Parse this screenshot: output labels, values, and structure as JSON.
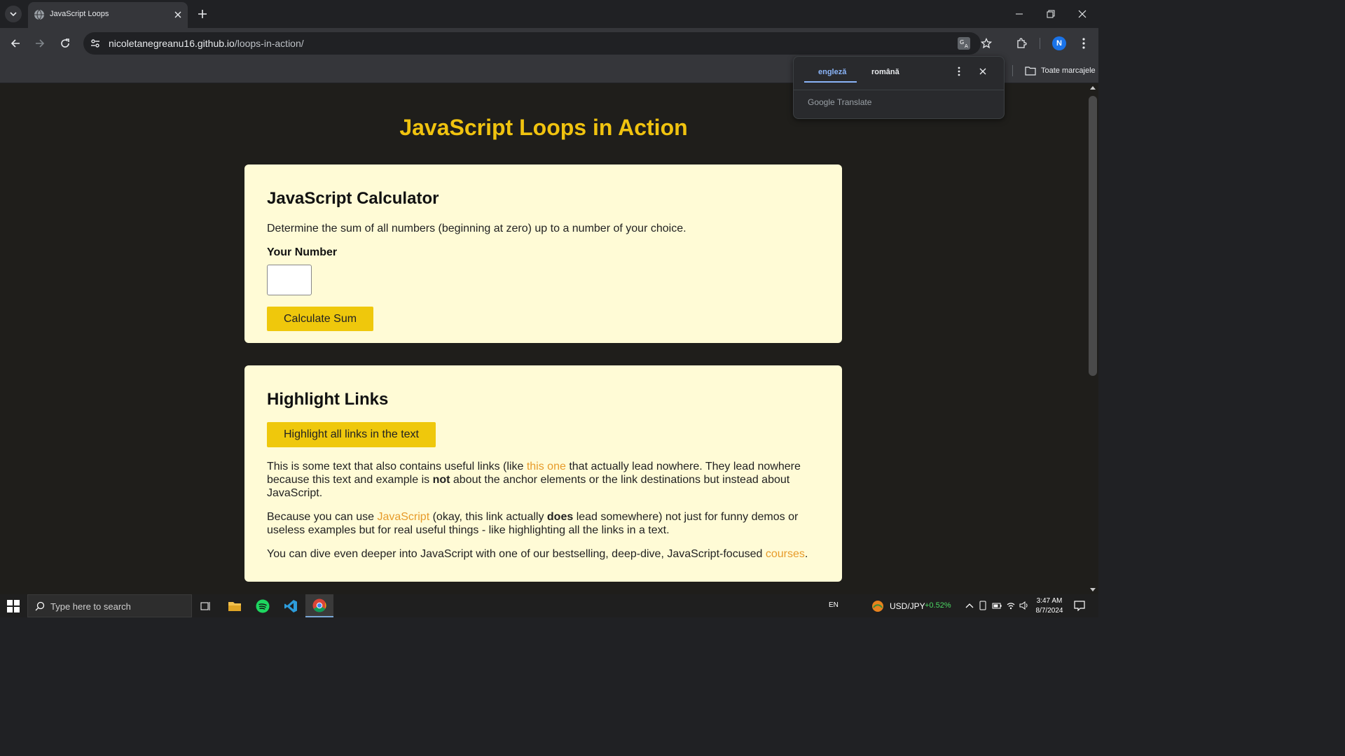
{
  "browser": {
    "tab_title": "JavaScript Loops",
    "url_host": "nicoletanegreanu16.github.io",
    "url_path": "/loops-in-action/",
    "avatar_letter": "N",
    "bookmarks_all": "Toate marcajele"
  },
  "translate_popup": {
    "lang_source": "engleză",
    "lang_target": "română",
    "brand_google": "Google",
    "brand_translate": "Translate"
  },
  "page": {
    "title": "JavaScript Loops in Action",
    "calculator": {
      "heading": "JavaScript Calculator",
      "description": "Determine the sum of all numbers (beginning at zero) up to a number of your choice.",
      "input_label": "Your Number",
      "input_value": "",
      "button_label": "Calculate Sum"
    },
    "links": {
      "heading": "Highlight Links",
      "button_label": "Highlight all links in the text",
      "p1_a": "This is some text that also contains useful links (like ",
      "p1_link": "this one",
      "p1_b": " that actually lead nowhere. They lead nowhere because this text and example is ",
      "p1_bold": "not",
      "p1_c": " about the anchor elements or the link destinations but instead about JavaScript.",
      "p2_a": "Because you can use ",
      "p2_link": "JavaScript",
      "p2_b": " (okay, this link actually ",
      "p2_bold": "does",
      "p2_c": " lead somewhere) not just for funny demos or useless examples but for real useful things - like highlighting all the links in a text.",
      "p3_a": "You can dive even deeper into JavaScript with one of our bestselling, deep-dive, JavaScript-focused ",
      "p3_link": "courses",
      "p3_b": "."
    }
  },
  "taskbar": {
    "search_placeholder": "Type here to search",
    "language": "EN",
    "ticker_name": "USD/JPY",
    "ticker_change": "+0.52%",
    "time": "3:47 AM",
    "date": "8/7/2024"
  },
  "colors": {
    "accent_yellow": "#f0c30f",
    "link_orange": "#e79b2a",
    "card_bg": "#fffbd6",
    "page_bg": "#1f1e1b",
    "ticker_green": "#4cd964"
  }
}
